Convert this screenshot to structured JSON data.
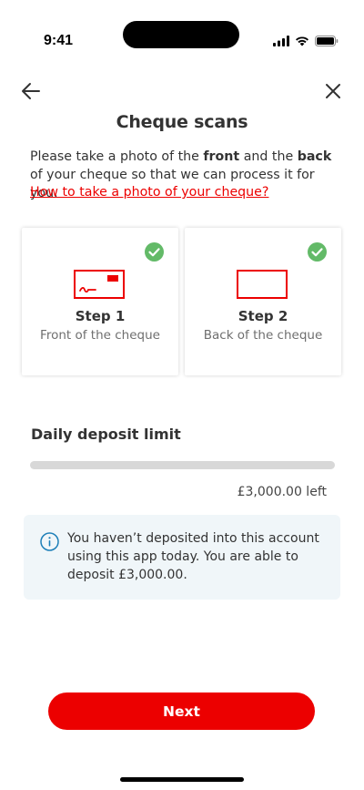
{
  "status_bar": {
    "time": "9:41",
    "icons": [
      "signal-icon",
      "wifi-icon",
      "battery-icon"
    ]
  },
  "nav": {
    "back_icon": "arrow-left-icon",
    "close_icon": "close-icon"
  },
  "page": {
    "title": "Cheque scans",
    "intro_part1": "Please take a photo of the ",
    "intro_front": "front",
    "intro_part2": " and the ",
    "intro_back": "back",
    "intro_part3": " of your cheque so that we can process it for you.",
    "help_link": "How to take a photo of your cheque?"
  },
  "steps": [
    {
      "title": "Step 1",
      "subtitle": "Front of the cheque",
      "completed": true,
      "icon": "cheque-front-icon"
    },
    {
      "title": "Step 2",
      "subtitle": "Back of the cheque",
      "completed": true,
      "icon": "cheque-back-icon"
    }
  ],
  "deposit_limit": {
    "title": "Daily deposit limit",
    "remaining_text": "£3,000.00 left",
    "used_fraction": 0
  },
  "info": {
    "icon": "info-icon",
    "message": "You haven’t deposited into this account using this app today. You are able to deposit £3,000.00."
  },
  "actions": {
    "next_label": "Next"
  },
  "colors": {
    "brand_red": "#ec0000",
    "success_green": "#63ba68",
    "info_blue": "#1d7fb8",
    "info_bg": "#f0f6f9"
  }
}
